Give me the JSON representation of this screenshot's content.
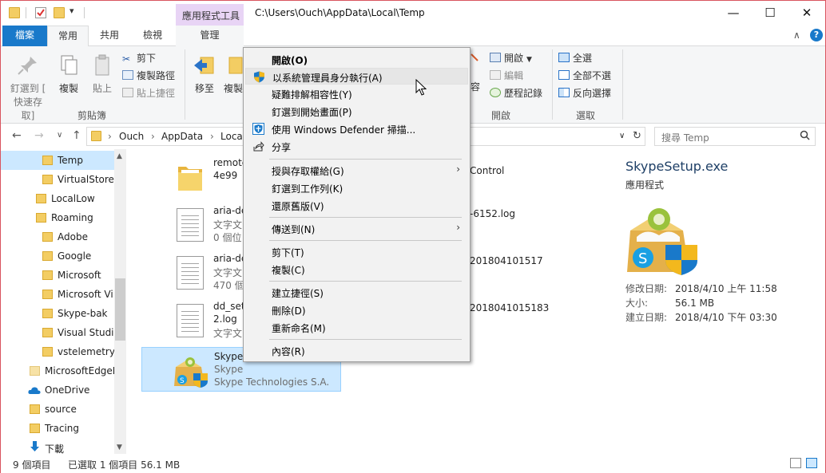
{
  "window": {
    "path": "C:\\Users\\Ouch\\AppData\\Local\\Temp",
    "contextual_tab_group": "應用程式工具",
    "controls": {
      "minimize": "—",
      "maximize": "☐",
      "close": "✕"
    }
  },
  "tabs": {
    "file": "檔案",
    "home": "常用",
    "share": "共用",
    "view": "檢視",
    "manage": "管理"
  },
  "ribbon": {
    "pin_line1": "釘選到 [",
    "pin_line2": "快速存取]",
    "copy": "複製",
    "paste": "貼上",
    "cut": "剪下",
    "copy_path": "複製路徑",
    "paste_shortcut": "貼上捷徑",
    "clipboard_group": "剪貼簿",
    "move_to": "移至",
    "copy_to": "複製",
    "open": "開啟",
    "edit": "編輯",
    "history": "歷程記錄",
    "open_group": "開啟",
    "select_all": "全選",
    "select_none": "全部不選",
    "invert_selection": "反向選擇",
    "select_group": "選取"
  },
  "address": {
    "back": "←",
    "forward": "→",
    "recent": "∨",
    "up": "↑",
    "segments": [
      "Ouch",
      "AppData",
      "Loca"
    ],
    "sep": "›",
    "dropdown": "∨",
    "refresh": "↻"
  },
  "search": {
    "placeholder": "搜尋 Temp",
    "icon": "search-icon"
  },
  "navpane": {
    "items": [
      {
        "label": "Temp"
      },
      {
        "label": "VirtualStore"
      },
      {
        "label": "LocalLow"
      },
      {
        "label": "Roaming"
      },
      {
        "label": "Adobe"
      },
      {
        "label": "Google"
      },
      {
        "label": "Microsoft"
      },
      {
        "label": "Microsoft Vi"
      },
      {
        "label": "Skype-bak"
      },
      {
        "label": "Visual Studio"
      },
      {
        "label": "vstelemetry"
      },
      {
        "label": "MicrosoftEdgeE"
      },
      {
        "label": "OneDrive"
      },
      {
        "label": "source"
      },
      {
        "label": "Tracing"
      },
      {
        "label": "下載"
      }
    ]
  },
  "files": [
    {
      "name": "remote",
      "l2": "4e99",
      "l3": ""
    },
    {
      "name": "aria-de",
      "l2": "文字文",
      "l3": "0 個位"
    },
    {
      "name": "aria-de",
      "l2": "文字文",
      "l3": "470 個"
    },
    {
      "name": "dd_set",
      "l2": "2.log",
      "l3": "文字文"
    },
    {
      "name": "SkypeS",
      "l2": "Skype",
      "l3": "Skype Technologies S.A."
    }
  ],
  "right_fragments": {
    "r1": "Control",
    "r2": "-6152.log",
    "r3": "201804101517",
    "r4": "2018041015183"
  },
  "details": {
    "title": "SkypeSetup.exe",
    "type": "應用程式",
    "modified_label": "修改日期:",
    "modified_value": "2018/4/10 上午 11:58",
    "size_label": "大小:",
    "size_value": "56.1 MB",
    "created_label": "建立日期:",
    "created_value": "2018/4/10 下午 03:30"
  },
  "status": {
    "count": "9 個項目",
    "selected": "已選取 1 個項目  56.1 MB"
  },
  "context_menu": {
    "open": "開啟(O)",
    "run_as_admin": "以系統管理員身分執行(A)",
    "troubleshoot": "疑難排解相容性(Y)",
    "pin_start": "釘選到開始畫面(P)",
    "defender": "使用 Windows Defender 掃描...",
    "share": "分享",
    "give_access": "授與存取權給(G)",
    "pin_taskbar": "釘選到工作列(K)",
    "restore": "還原舊版(V)",
    "send_to": "傳送到(N)",
    "cut": "剪下(T)",
    "copy": "複製(C)",
    "create_shortcut": "建立捷徑(S)",
    "delete": "刪除(D)",
    "rename": "重新命名(M)",
    "properties": "內容(R)",
    "submenu_arrow": "›"
  },
  "colors": {
    "accent": "#1979ca",
    "selection": "#cce8ff",
    "contextual_tab": "#e8d4f5",
    "folder": "#f3cd63"
  }
}
